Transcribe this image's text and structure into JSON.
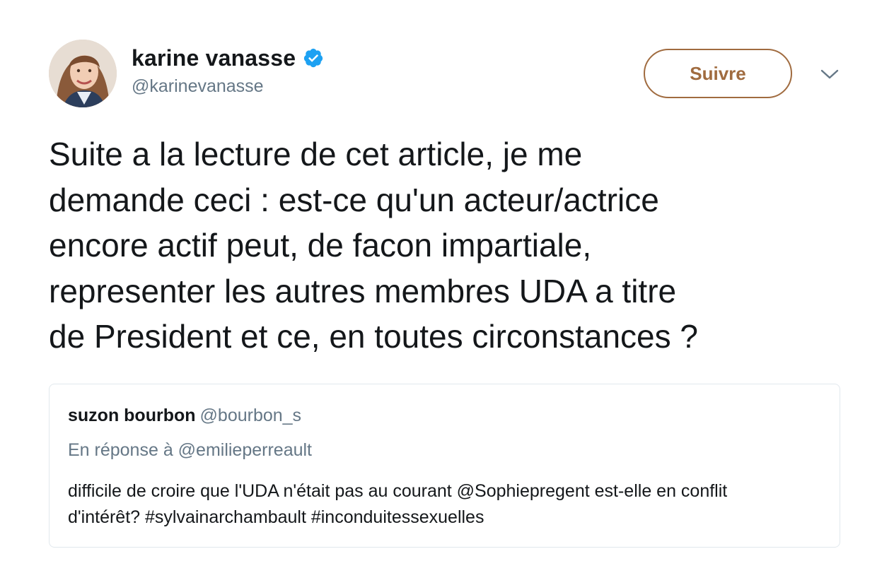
{
  "tweet": {
    "author": {
      "display_name": "karine vanasse",
      "handle": "@karinevanasse",
      "verified": true,
      "avatar_icon": "user-avatar"
    },
    "follow_label": "Suivre",
    "menu_icon": "chevron-down-icon",
    "text": "Suite a la lecture de cet article, je me\ndemande ceci : est-ce qu'un acteur/actrice\nencore actif peut, de facon impartiale,\nrepresenter les autres membres UDA a titre\nde President et ce, en toutes circonstances ?"
  },
  "quoted_tweet": {
    "display_name": "suzon bourbon",
    "handle": "@bourbon_s",
    "reply_context": "En réponse à @emilieperreault",
    "text": "difficile de croire que l'UDA n'était pas au courant @Sophiepregent est-elle en conflit\nd'intérêt? #sylvainarchambault #inconduitessexuelles"
  },
  "colors": {
    "text_primary": "#14171a",
    "text_secondary": "#657786",
    "follow_accent": "#a06b3f",
    "verified_blue": "#1da1f2",
    "border": "#e1e8ed"
  }
}
